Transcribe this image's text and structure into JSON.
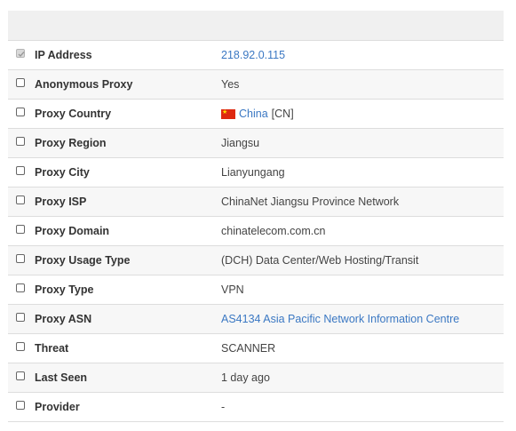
{
  "rows": [
    {
      "label": "IP Address",
      "value": "218.92.0.115",
      "checked": true,
      "link": true
    },
    {
      "label": "Anonymous Proxy",
      "value": "Yes",
      "checked": false,
      "link": false
    },
    {
      "label": "Proxy Country",
      "country_name": "China",
      "country_code": "[CN]",
      "flag_icon": "china-flag",
      "checked": false
    },
    {
      "label": "Proxy Region",
      "value": "Jiangsu",
      "checked": false,
      "link": false
    },
    {
      "label": "Proxy City",
      "value": "Lianyungang",
      "checked": false,
      "link": false
    },
    {
      "label": "Proxy ISP",
      "value": "ChinaNet Jiangsu Province Network",
      "checked": false,
      "link": false
    },
    {
      "label": "Proxy Domain",
      "value": "chinatelecom.com.cn",
      "checked": false,
      "link": false
    },
    {
      "label": "Proxy Usage Type",
      "value": "(DCH) Data Center/Web Hosting/Transit",
      "checked": false,
      "link": false
    },
    {
      "label": "Proxy Type",
      "value": "VPN",
      "checked": false,
      "link": false
    },
    {
      "label": "Proxy ASN",
      "value": "AS4134 Asia Pacific Network Information Centre",
      "checked": false,
      "link": true
    },
    {
      "label": "Threat",
      "value": "SCANNER",
      "checked": false,
      "link": false
    },
    {
      "label": "Last Seen",
      "value": "1 day ago",
      "checked": false,
      "link": false
    },
    {
      "label": "Provider",
      "value": "-",
      "checked": false,
      "link": false
    }
  ],
  "colors": {
    "link": "#3b78c3",
    "header_bg": "#f0f0f0",
    "alt_row_bg": "#f7f7f7",
    "border": "#dddddd"
  }
}
